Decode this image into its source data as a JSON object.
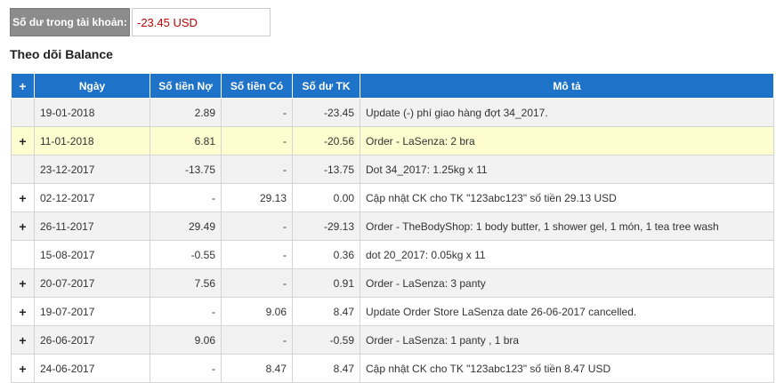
{
  "balance": {
    "label": "Số dư trong tài khoản:",
    "value": "-23.45 USD"
  },
  "section_title": "Theo dõi Balance",
  "table": {
    "expand_all": "+",
    "headers": [
      "Ngày",
      "Số tiền Nợ",
      "Số tiền Có",
      "Số dư TK",
      "Mô tả"
    ],
    "rows": [
      {
        "expand": "",
        "date": "19-01-2018",
        "debit": "2.89",
        "credit": "-",
        "balance": "-23.45",
        "desc": "Update (-) phí giao hàng đợt 34_2017."
      },
      {
        "expand": "+",
        "date": "11-01-2018",
        "debit": "6.81",
        "credit": "-",
        "balance": "-20.56",
        "desc": "Order - LaSenza: 2 bra"
      },
      {
        "expand": "",
        "date": "23-12-2017",
        "debit": "-13.75",
        "credit": "-",
        "balance": "-13.75",
        "desc": "Dot 34_2017: 1.25kg x 11"
      },
      {
        "expand": "+",
        "date": "02-12-2017",
        "debit": "-",
        "credit": "29.13",
        "balance": "0.00",
        "desc": "Cập nhật CK cho TK \"123abc123\" số tiền 29.13 USD"
      },
      {
        "expand": "+",
        "date": "26-11-2017",
        "debit": "29.49",
        "credit": "-",
        "balance": "-29.13",
        "desc": "Order - TheBodyShop: 1 body butter, 1 shower gel, 1 món, 1 tea tree wash"
      },
      {
        "expand": "",
        "date": "15-08-2017",
        "debit": "-0.55",
        "credit": "-",
        "balance": "0.36",
        "desc": "dot 20_2017: 0.05kg x 11"
      },
      {
        "expand": "+",
        "date": "20-07-2017",
        "debit": "7.56",
        "credit": "-",
        "balance": "0.91",
        "desc": "Order - LaSenza: 3 panty"
      },
      {
        "expand": "+",
        "date": "19-07-2017",
        "debit": "-",
        "credit": "9.06",
        "balance": "8.47",
        "desc": "Update Order Store LaSenza date 26-06-2017 cancelled."
      },
      {
        "expand": "+",
        "date": "26-06-2017",
        "debit": "9.06",
        "credit": "-",
        "balance": "-0.59",
        "desc": "Order - LaSenza: 1 panty , 1 bra"
      },
      {
        "expand": "+",
        "date": "24-06-2017",
        "debit": "-",
        "credit": "8.47",
        "balance": "8.47",
        "desc": "Cập nhật CK cho TK \"123abc123\" số tiền 8.47 USD"
      }
    ]
  },
  "colors": {
    "header_bg": "#1e73c8",
    "label_bg": "#8c8c8c",
    "balance_value": "#c00000",
    "highlight_row": "#fdfdd0"
  }
}
